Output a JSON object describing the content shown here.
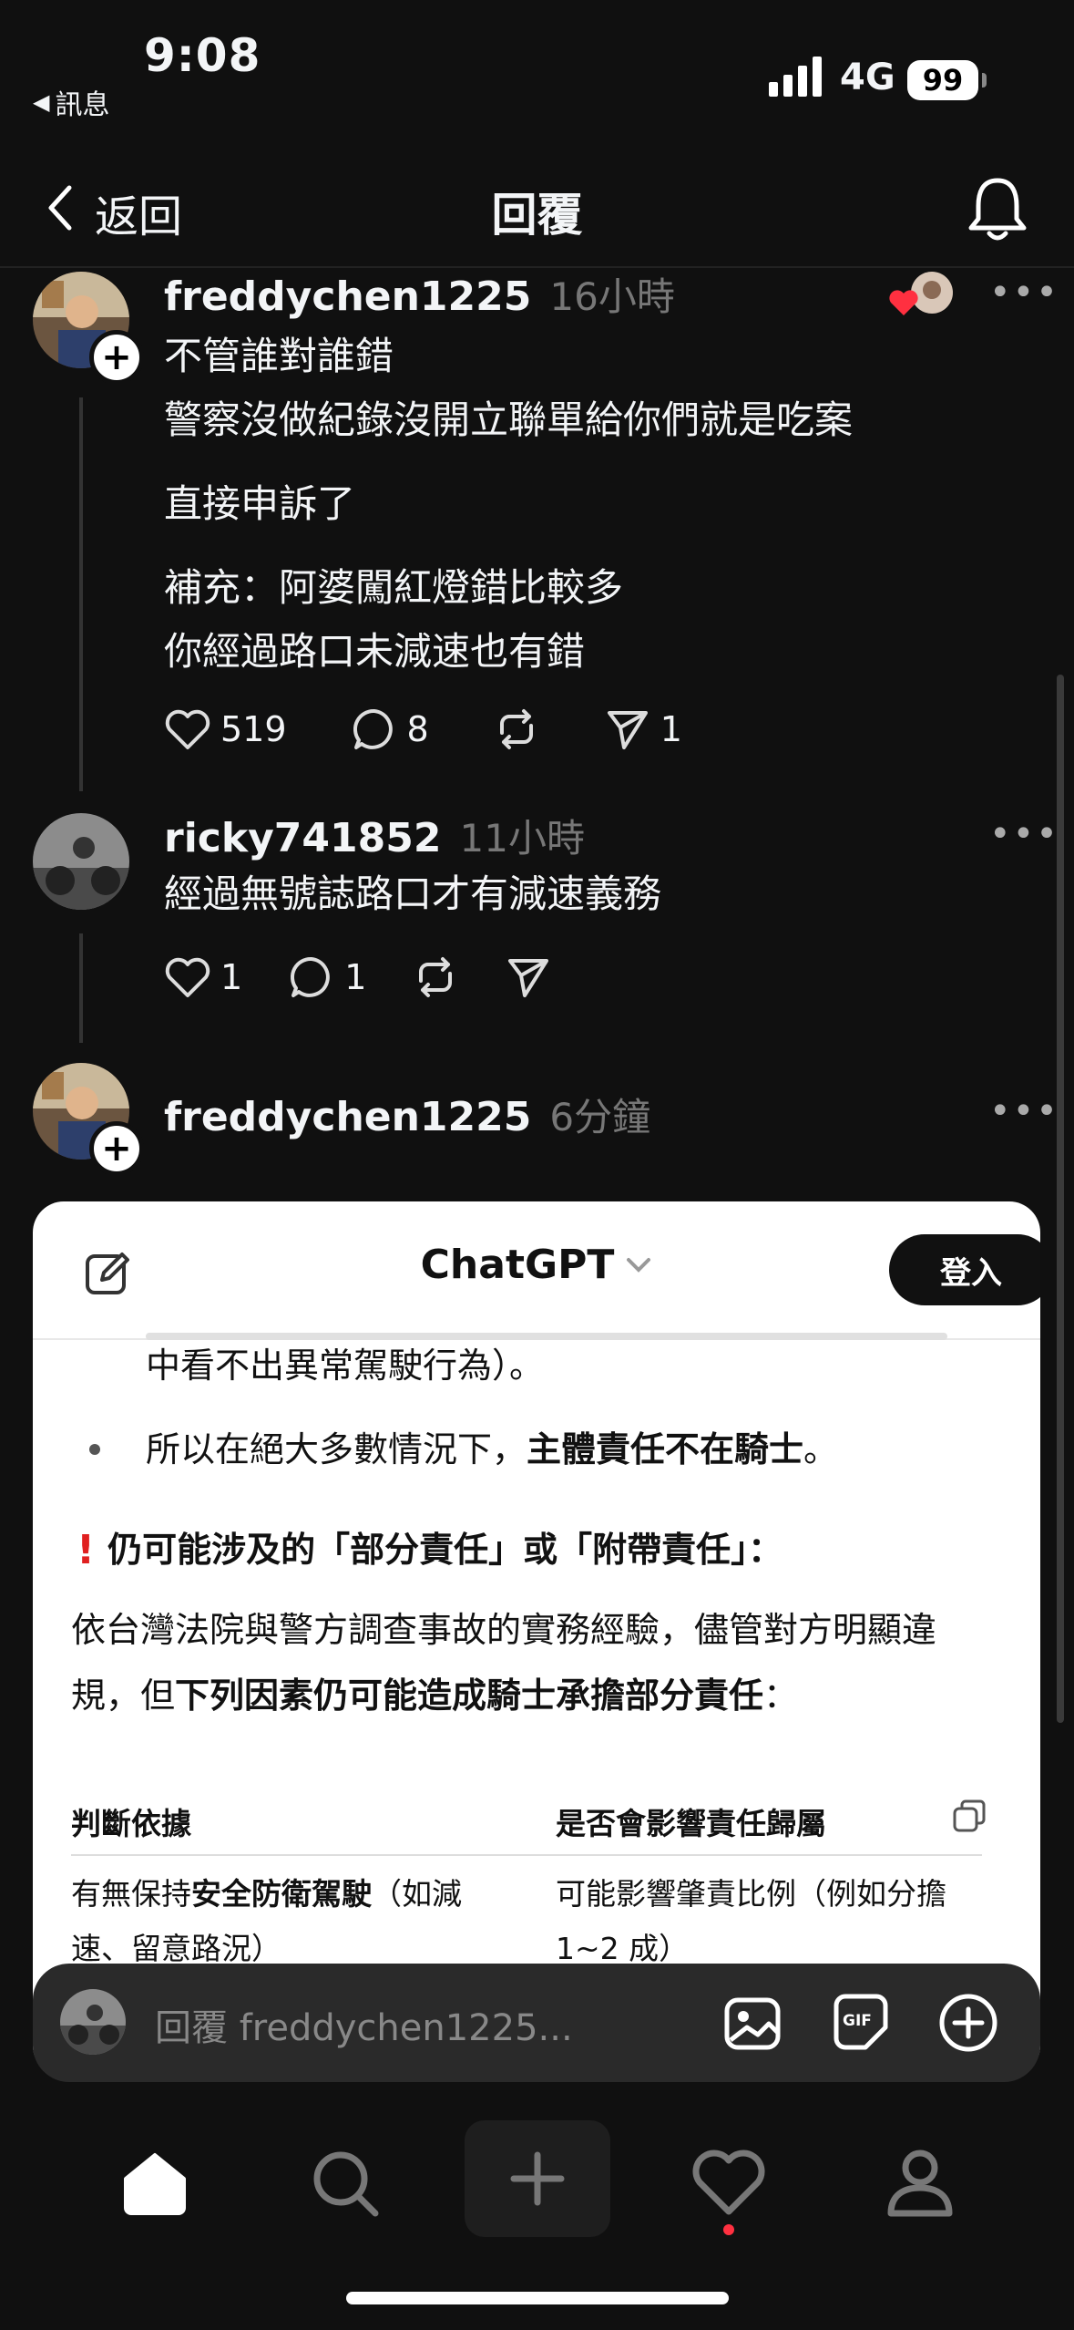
{
  "status": {
    "time": "9:08",
    "back_app": "訊息",
    "network": "4G",
    "battery": "99"
  },
  "nav": {
    "back_label": "返回",
    "title": "回覆"
  },
  "posts": [
    {
      "username": "freddychen1225",
      "time": "16小時",
      "paragraphs": [
        "不管誰對誰錯",
        "警察沒做紀錄沒開立聯單給你們就是吃案",
        "直接申訴了",
        "補充：阿婆闖紅燈錯比較多",
        "你經過路口未減速也有錯"
      ],
      "likes": "519",
      "replies": "8",
      "shares": "1"
    },
    {
      "username": "ricky741852",
      "time": "11小時",
      "text": "經過無號誌路口才有減速義務",
      "likes": "1",
      "replies": "1"
    },
    {
      "username": "freddychen1225",
      "time": "6分鐘"
    }
  ],
  "chatgpt": {
    "title": "ChatGPT",
    "login": "登入",
    "line1": "中看不出異常駕駛行為）。",
    "bullet_prefix": "所以在絕大多數情況下，",
    "bullet_bold": "主體責任不在騎士",
    "bullet_suffix": "。",
    "heading": "仍可能涉及的「部分責任」或「附帶責任」：",
    "para_line1": "依台灣法院與警方調查事故的實務經驗，儘管對方明顯違",
    "para_line2_prefix": "規，但",
    "para_line2_bold": "下列因素仍可能造成騎士承擔部分責任",
    "para_line2_suffix": "：",
    "table_headers": [
      "判斷依據",
      "是否會影響責任歸屬"
    ],
    "row1_col1_prefix": "有無保持",
    "row1_col1_bold": "安全防衛駕駛",
    "row1_col1_suffix": "（如減",
    "row1_col1_line2": "速、留意路況）",
    "row1_col2_line1": "可能影響肇責比例（例如分擔",
    "row1_col2_line2": "1~2 成）"
  },
  "reply_bar": {
    "placeholder": "回覆 freddychen1225..."
  },
  "colors": {
    "background": "#101010",
    "like_dot": "#ff3040",
    "badge_heart": "#ff3040"
  }
}
